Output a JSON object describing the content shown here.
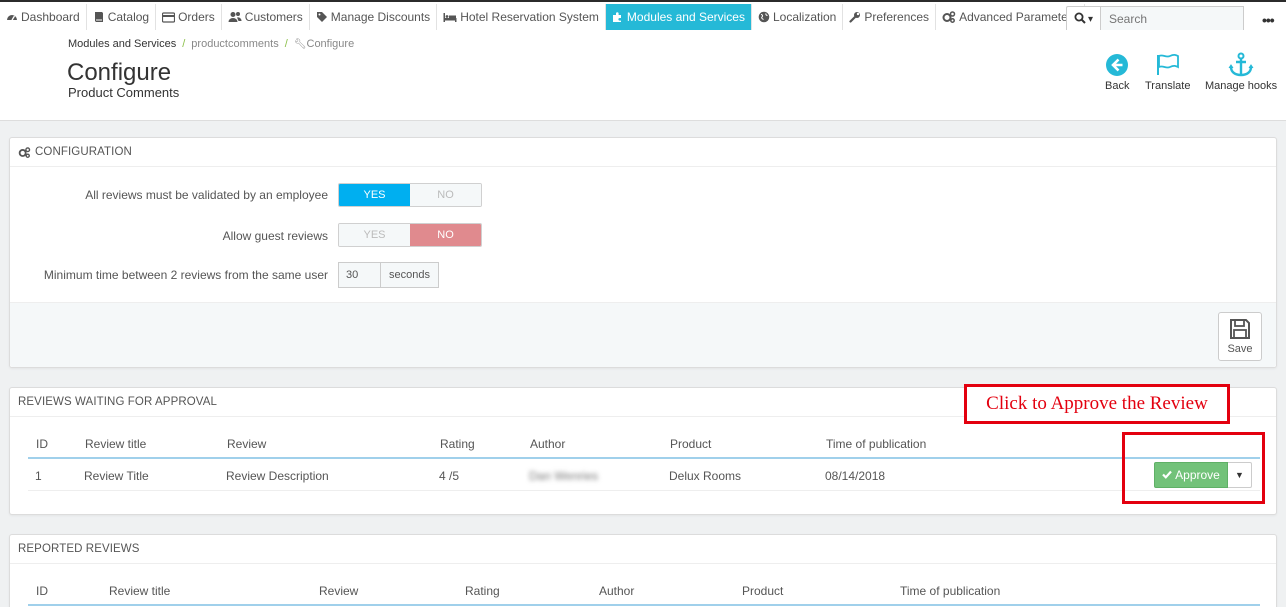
{
  "nav": {
    "items": [
      {
        "label": "Dashboard",
        "icon": "dashboard-icon"
      },
      {
        "label": "Catalog",
        "icon": "book-icon"
      },
      {
        "label": "Orders",
        "icon": "credit-card-icon"
      },
      {
        "label": "Customers",
        "icon": "users-icon"
      },
      {
        "label": "Manage Discounts",
        "icon": "tag-icon"
      },
      {
        "label": "Hotel Reservation System",
        "icon": "bed-icon"
      },
      {
        "label": "Modules and Services",
        "icon": "puzzle-icon",
        "active": true
      },
      {
        "label": "Localization",
        "icon": "globe-icon"
      },
      {
        "label": "Preferences",
        "icon": "wrench-icon"
      },
      {
        "label": "Advanced Parameters",
        "icon": "cogs-icon"
      }
    ],
    "search_placeholder": "Search",
    "more": "•••"
  },
  "header": {
    "breadcrumb": [
      "Modules and Services",
      "productcomments",
      "Configure"
    ],
    "title": "Configure",
    "subtitle": "Product Comments",
    "toolbar": {
      "back": "Back",
      "translate": "Translate",
      "manage_hooks": "Manage hooks"
    }
  },
  "config": {
    "heading": "CONFIGURATION",
    "validate_label": "All reviews must be validated by an employee",
    "validate_value": "YES",
    "guest_label": "Allow guest reviews",
    "guest_value": "NO",
    "yes": "YES",
    "no": "NO",
    "min_time_label": "Minimum time between 2 reviews from the same user",
    "min_time_value": "30",
    "min_time_unit": "seconds",
    "save": "Save"
  },
  "waiting": {
    "heading": "REVIEWS WAITING FOR APPROVAL",
    "columns": [
      "ID",
      "Review title",
      "Review",
      "Rating",
      "Author",
      "Product",
      "Time of publication"
    ],
    "rows": [
      {
        "id": "1",
        "title": "Review Title",
        "review": "Review Description",
        "rating": "4 /5",
        "author": "Dan Wenries",
        "product": "Delux Rooms",
        "time": "08/14/2018"
      }
    ],
    "approve": "Approve"
  },
  "reported": {
    "heading": "REPORTED REVIEWS",
    "columns": [
      "ID",
      "Review title",
      "Review",
      "Rating",
      "Author",
      "Product",
      "Time of publication"
    ]
  },
  "annotation": {
    "text": "Click to Approve the Review",
    "color": "#e3000f"
  },
  "colors": {
    "accent": "#25b9d7",
    "yes_on": "#00aff0",
    "no_on": "#e08a8e",
    "approve": "#72c279"
  }
}
